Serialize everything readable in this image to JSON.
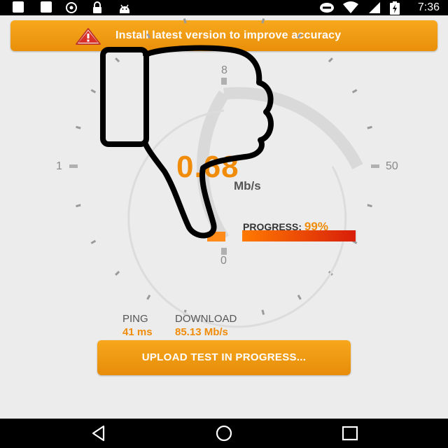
{
  "status_bar": {
    "time": "7:36",
    "icons": [
      "facebook-icon",
      "facebook-icon",
      "location-icon",
      "lock-icon",
      "android-icon",
      "do-not-disturb-icon",
      "wifi-icon",
      "signal-icon",
      "battery-charging-icon"
    ]
  },
  "banner": {
    "text": "Install latest version to improve accuracy",
    "icon": "warning-icon"
  },
  "gauge": {
    "value": "0.68",
    "unit": "Mb/s",
    "labels": {
      "top": "8",
      "left": "1",
      "right": "50",
      "bottom": "0"
    }
  },
  "progress": {
    "label": "PROGRESS:",
    "percent_text": "99%",
    "percent": 99
  },
  "stats": {
    "ping": {
      "label": "PING",
      "value": "41 ms"
    },
    "download": {
      "label": "DOWNLOAD",
      "value": "85.13 Mb/s"
    }
  },
  "upload_button": {
    "label": "UPLOAD TEST IN PROGRESS..."
  },
  "nav_bar": {
    "icons": [
      "back-icon",
      "home-icon",
      "recents-icon"
    ]
  },
  "colors": {
    "accent": "#f08c0a",
    "banner": "#f4a11a",
    "progress_start": "#ff7a00",
    "progress_end": "#d81e0a",
    "background": "#ececec"
  }
}
